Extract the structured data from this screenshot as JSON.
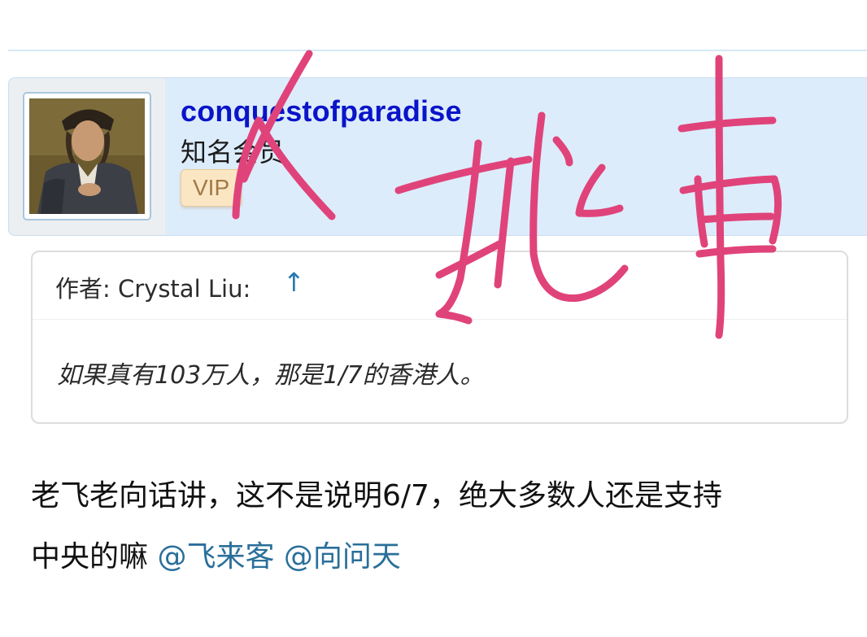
{
  "user": {
    "username": "conquestofparadise",
    "rank": "知名会员",
    "badge": "VIP",
    "avatar_icon": "portrait-avatar"
  },
  "quote": {
    "author_prefix": "作者: Crystal Liu:",
    "jump_arrow": "↑",
    "text": "如果真有103万人，那是1/7的香港人。"
  },
  "post": {
    "line1": "老飞老向话讲，这不是说明6/7，绝大多数人还是支持",
    "line2_text": "中央的嘛 ",
    "mentions": [
      "@飞来客",
      "@向问天"
    ]
  },
  "handwriting": {
    "text": "X 挑事",
    "color": "#e0437a"
  },
  "colors": {
    "username": "#0a14c8",
    "card_bg": "#dcecfb",
    "mention": "#2a6f9a",
    "vip_bg": "#fbe6c4"
  }
}
